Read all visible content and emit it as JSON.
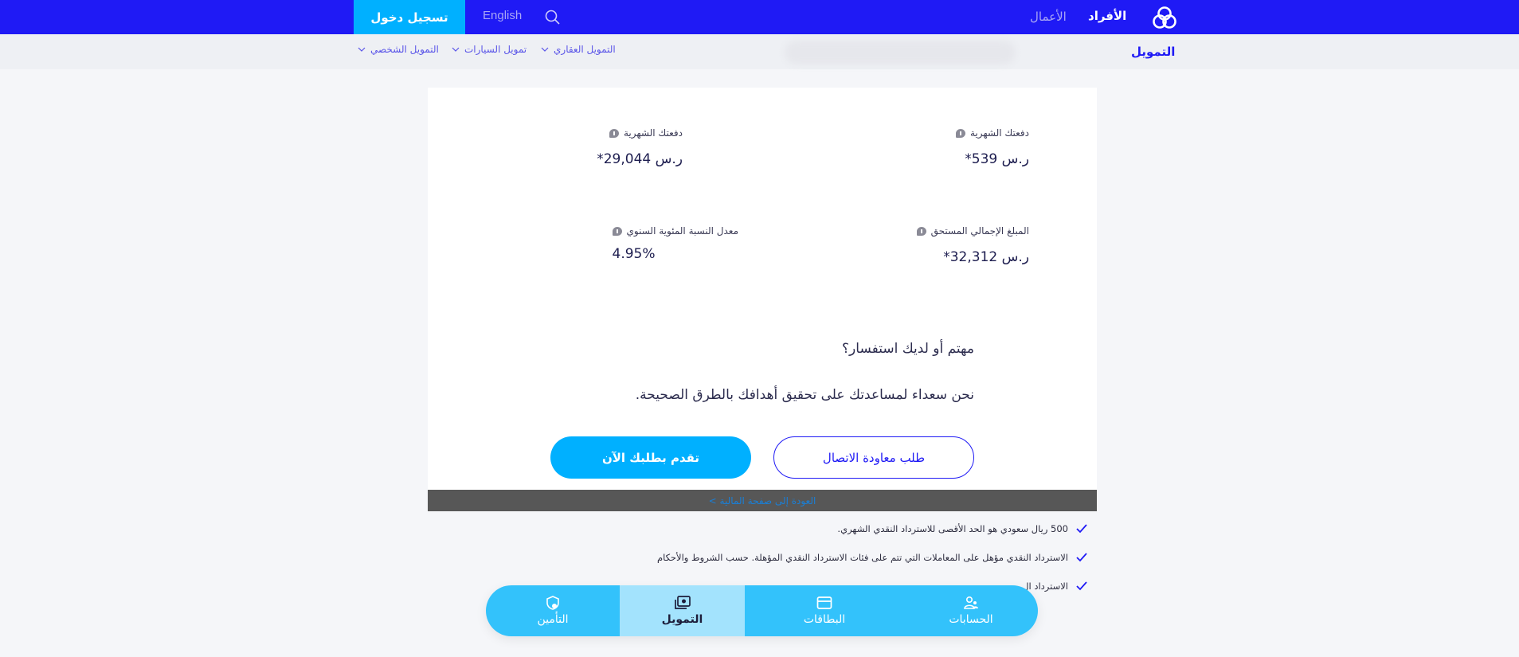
{
  "header": {
    "nav_individuals": "الأفراد",
    "nav_business": "الأعمال",
    "language_label": "English",
    "login_label": "تسجيل دخول",
    "brand_color": "#1f1af5",
    "accent_color": "#00b0ff"
  },
  "subheader": {
    "title": "التمويل",
    "menu": [
      {
        "label": "التمويل العقاري"
      },
      {
        "label": "تمويل السيارات"
      },
      {
        "label": "التمويل الشخصي"
      }
    ]
  },
  "results": {
    "monthly_payment_1": {
      "label": "دفعتك الشهرية",
      "value": "ر.س 539*"
    },
    "monthly_payment_2": {
      "label": "دفعتك الشهرية",
      "value": "ر.س 29,044*"
    },
    "total_amount": {
      "label": "المبلغ الإجمالي المستحق",
      "value": "ر.س 32,312*"
    },
    "apr": {
      "label": "معدل النسبة المئوية السنوي",
      "value": "4.95%"
    }
  },
  "inquiry": {
    "question": "مهتم أو لديك استفسار؟",
    "subtitle": "نحن سعداء لمساعدتك على تحقيق أهدافك بالطرق الصحيحة.",
    "callback_label": "طلب معاودة الاتصال",
    "apply_label": "تقدم بطلبك الآن"
  },
  "back_link": "العودة إلى صفحة المالية >",
  "features": [
    "500 ريال سعودي هو الحد الأقصى للاسترداد النقدي الشهري.",
    "الاسترداد النقدي مؤهل على المعاملات التي تتم على فئات الاسترداد النقدي المؤهلة. حسب الشروط والأحكام",
    "الاسترداد ال"
  ],
  "bottom_nav": {
    "items": [
      {
        "label": "الحسابات",
        "icon": "accounts-icon"
      },
      {
        "label": "البطاقات",
        "icon": "card-icon"
      },
      {
        "label": "التمويل",
        "icon": "finance-icon",
        "active": true
      },
      {
        "label": "التأمين",
        "icon": "insurance-icon"
      }
    ]
  }
}
